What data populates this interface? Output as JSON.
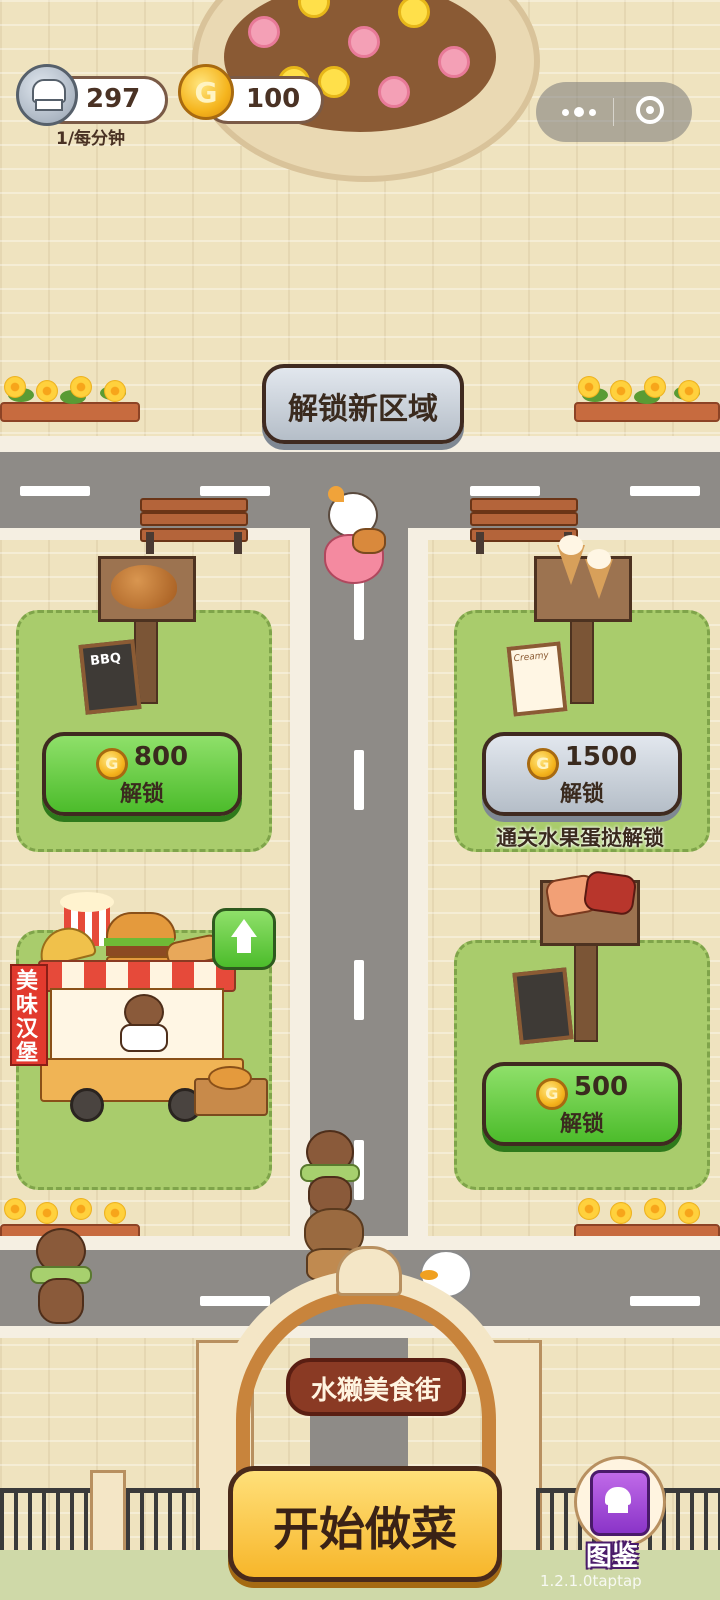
{
  "hud": {
    "chef_points": "297",
    "chef_rate": "1/每分钟",
    "coins": "100",
    "coin_symbol": "G"
  },
  "unlock_area_label": "解锁新区域",
  "stalls": {
    "bbq": {
      "sign_text": "BBQ",
      "price": "800",
      "action": "解锁",
      "state": "available"
    },
    "icecream": {
      "sign_text": "Creamy",
      "price": "1500",
      "action": "解锁",
      "state": "locked",
      "requirement": "通关水果蛋挞解锁"
    },
    "sushi": {
      "price": "500",
      "action": "解锁",
      "state": "available"
    },
    "burger": {
      "banner": "美味汉堡",
      "upgrade_icon": "up-arrow-icon"
    }
  },
  "gate_title": "水獭美食街",
  "start_button": "开始做菜",
  "catalog_label": "图鉴",
  "version": "1.2.1.0taptap",
  "colors": {
    "green_button": "#4cbc2b",
    "gray_button": "#b5bec8",
    "coin": "#f5b51e",
    "road": "#8e8b87"
  }
}
